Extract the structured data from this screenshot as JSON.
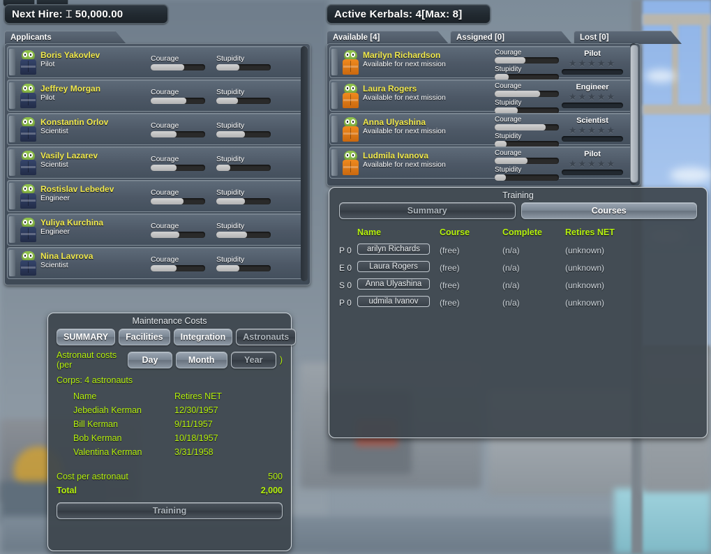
{
  "header": {
    "next_hire_label": "Next Hire: ⌶ 50,000.00",
    "active_kerbals_label": "Active Kerbals: 4[Max: 8]"
  },
  "applicants_panel": {
    "tab_label": "Applicants",
    "stat_labels": {
      "courage": "Courage",
      "stupidity": "Stupidity"
    },
    "rows": [
      {
        "name": "Boris Yakovlev",
        "role": "Pilot",
        "courage": 62,
        "stupidity": 42
      },
      {
        "name": "Jeffrey Morgan",
        "role": "Pilot",
        "courage": 66,
        "stupidity": 40
      },
      {
        "name": "Konstantin Orlov",
        "role": "Scientist",
        "courage": 47,
        "stupidity": 53
      },
      {
        "name": "Vasily Lazarev",
        "role": "Scientist",
        "courage": 48,
        "stupidity": 26
      },
      {
        "name": "Rostislav Lebedev",
        "role": "Engineer",
        "courage": 60,
        "stupidity": 53
      },
      {
        "name": "Yuliya Kurchina",
        "role": "Engineer",
        "courage": 52,
        "stupidity": 56
      },
      {
        "name": "Nina Lavrova",
        "role": "Scientist",
        "courage": 47,
        "stupidity": 42
      }
    ]
  },
  "active_panel": {
    "tabs": [
      {
        "label": "Available [4]",
        "active": true
      },
      {
        "label": "Assigned [0]",
        "active": false
      },
      {
        "label": "Lost [0]",
        "active": false
      }
    ],
    "stat_labels": {
      "courage": "Courage",
      "stupidity": "Stupidity"
    },
    "rows": [
      {
        "name": "Marilyn Richardson",
        "status": "Available for next mission",
        "role": "Pilot",
        "stars": 5,
        "courage": 48,
        "stupidity": 22
      },
      {
        "name": "Laura Rogers",
        "status": "Available for next mission",
        "role": "Engineer",
        "stars": 5,
        "courage": 71,
        "stupidity": 36
      },
      {
        "name": "Anna Ulyashina",
        "status": "Available for next mission",
        "role": "Scientist",
        "stars": 5,
        "courage": 79,
        "stupidity": 19
      },
      {
        "name": "Ludmila Ivanova",
        "status": "Available for next mission",
        "role": "Pilot",
        "stars": 5,
        "courage": 51,
        "stupidity": 17
      }
    ]
  },
  "training_dialog": {
    "title": "Training",
    "tabs": [
      {
        "label": "Summary",
        "active": true
      },
      {
        "label": "Courses",
        "active": false
      }
    ],
    "columns": [
      "Name",
      "Course",
      "Complete",
      "Retires NET"
    ],
    "rows": [
      {
        "prefix": "P 0",
        "name": "arilyn Richards",
        "course": "(free)",
        "complete": "(n/a)",
        "retires": "(unknown)"
      },
      {
        "prefix": "E 0",
        "name": "Laura Rogers",
        "course": "(free)",
        "complete": "(n/a)",
        "retires": "(unknown)"
      },
      {
        "prefix": "S 0",
        "name": "Anna Ulyashina",
        "course": "(free)",
        "complete": "(n/a)",
        "retires": "(unknown)"
      },
      {
        "prefix": "P 0",
        "name": "udmila Ivanov",
        "course": "(free)",
        "complete": "(n/a)",
        "retires": "(unknown)"
      }
    ]
  },
  "maintenance_dialog": {
    "title": "Maintenance Costs",
    "category_tabs": [
      {
        "label": "SUMMARY",
        "active": false
      },
      {
        "label": "Facilities",
        "active": false
      },
      {
        "label": "Integration",
        "active": false
      },
      {
        "label": "Astronauts",
        "active": true
      }
    ],
    "costs_prefix": "Astronaut costs (per",
    "costs_suffix": ")",
    "period_tabs": [
      {
        "label": "Day",
        "active": false
      },
      {
        "label": "Month",
        "active": false
      },
      {
        "label": "Year",
        "active": true
      }
    ],
    "corps_line": "Corps: 4 astronauts",
    "columns": [
      "Name",
      "Retires NET"
    ],
    "rows": [
      {
        "name": "Jebediah Kerman",
        "retires": "12/30/1957"
      },
      {
        "name": "Bill Kerman",
        "retires": "9/11/1957"
      },
      {
        "name": "Bob Kerman",
        "retires": "10/18/1957"
      },
      {
        "name": "Valentina Kerman",
        "retires": "3/31/1958"
      }
    ],
    "cost_per_label": "Cost per astronaut",
    "cost_per_value": "500",
    "total_label": "Total",
    "total_value": "2,000",
    "training_button": "Training"
  },
  "colors": {
    "name_yellow": "#f2ea4d",
    "label_green": "#b6f20d",
    "panel_slate": "#4b5663",
    "kerbal_green": "#8fc14b",
    "suit_blue": "#35456b",
    "suit_orange": "#f08a1e"
  }
}
